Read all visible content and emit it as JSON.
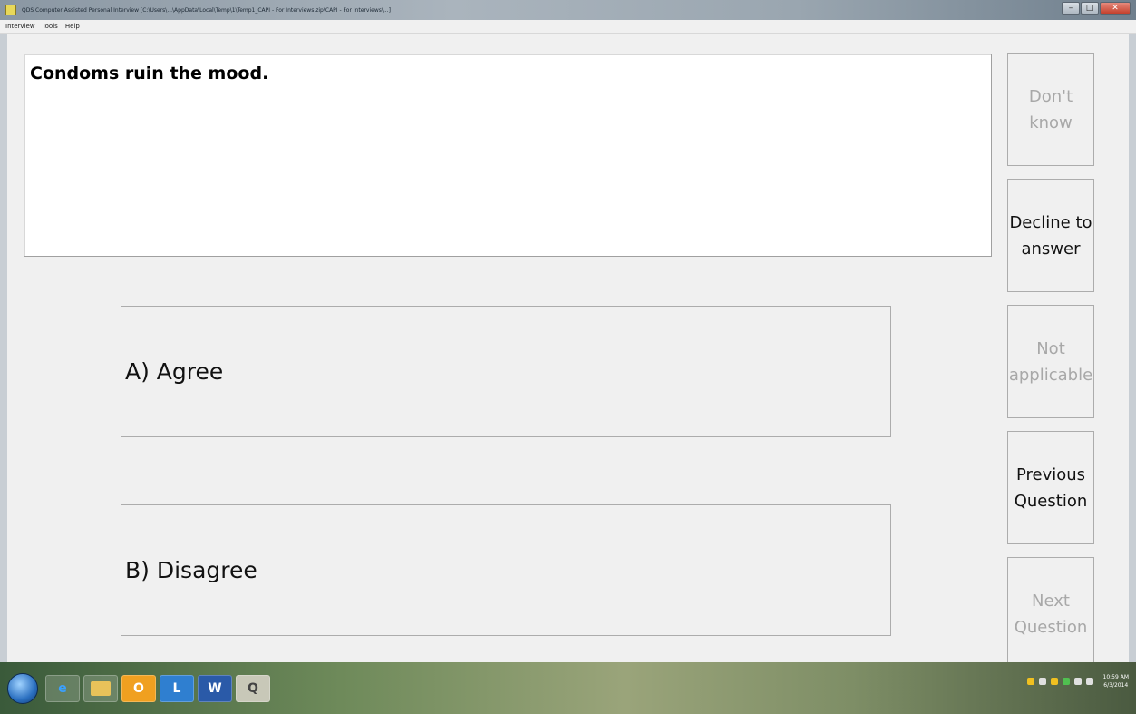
{
  "window": {
    "title": "QDS Computer Assisted Personal Interview [C:\\Users\\...\\AppData\\Local\\Temp\\1\\Temp1_CAPI - For Interviews.zip\\CAPI - For Interviews\\...]",
    "controls": {
      "minimize": "–",
      "maximize": "□",
      "close": "✕"
    }
  },
  "menu": {
    "items": [
      "Interview",
      "Tools",
      "Help"
    ]
  },
  "question": {
    "text": "Condoms ruin the mood."
  },
  "answers": [
    {
      "label": "A) Agree"
    },
    {
      "label": "B) Disagree"
    }
  ],
  "side_buttons": {
    "dont_know": {
      "line1": "Don't",
      "line2": "know",
      "enabled": false
    },
    "decline": {
      "line1": "Decline to",
      "line2": "answer",
      "enabled": true
    },
    "not_applicable": {
      "line1": "Not",
      "line2": "applicable",
      "enabled": false
    },
    "previous": {
      "line1": "Previous",
      "line2": "Question",
      "enabled": true
    },
    "next": {
      "line1": "Next",
      "line2": "Question",
      "enabled": false
    }
  },
  "taskbar": {
    "apps": [
      {
        "name": "internet-explorer",
        "glyph": "e"
      },
      {
        "name": "file-explorer",
        "glyph": ""
      },
      {
        "name": "outlook",
        "glyph": "O"
      },
      {
        "name": "lync",
        "glyph": "L"
      },
      {
        "name": "word",
        "glyph": "W"
      },
      {
        "name": "interview-app",
        "glyph": "Q"
      }
    ],
    "clock": {
      "time": "10:59 AM",
      "date": "6/3/2014"
    }
  },
  "colors": {
    "client_bg": "#f0f0f0",
    "button_border": "#acacac",
    "disabled_text": "#a8a8a8"
  }
}
